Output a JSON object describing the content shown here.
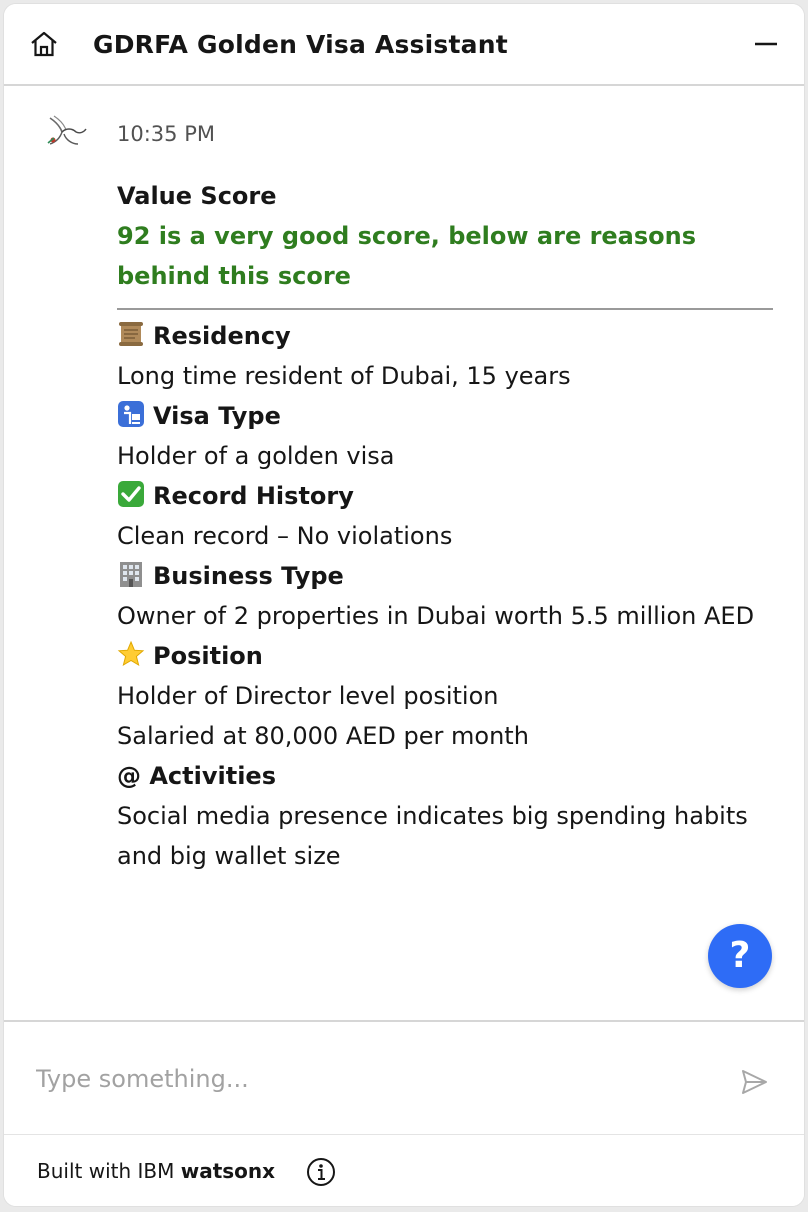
{
  "header": {
    "title": "GDRFA Golden Visa Assistant",
    "home_icon": "home-icon",
    "minimize_icon": "minimize-icon"
  },
  "message": {
    "avatar_icon": "bird-logo-icon",
    "time": "10:35 PM",
    "score_title": "Value Score",
    "score_subtitle": "92 is a very good score, below are reasons behind this score",
    "score": 92,
    "sections": [
      {
        "icon": "scroll-icon",
        "title": "Residency",
        "lines": [
          "Long time resident of Dubai, 15 years"
        ]
      },
      {
        "icon": "passport-control-icon",
        "title": "Visa Type",
        "lines": [
          "Holder of a golden visa"
        ]
      },
      {
        "icon": "check-mark-icon",
        "title": "Record History",
        "lines": [
          "Clean record – No violations"
        ]
      },
      {
        "icon": "office-building-icon",
        "title": "Business Type",
        "lines": [
          "Owner of 2 properties in Dubai worth 5.5 million AED"
        ]
      },
      {
        "icon": "star-icon",
        "title": "Position",
        "lines": [
          "Holder of Director level position",
          "Salaried at 80,000 AED per month"
        ]
      },
      {
        "icon": "at-sign",
        "title": "@ Activities",
        "lines": [
          "Social media presence indicates big spending habits and big wallet size"
        ]
      }
    ]
  },
  "help": {
    "label": "?"
  },
  "input": {
    "placeholder": "Type something...",
    "value": ""
  },
  "footer": {
    "prefix": "Built with IBM ",
    "brand": "watsonx"
  },
  "colors": {
    "accent": "#2e6cf6",
    "score_green": "#2f7d1f",
    "text": "#161616",
    "muted": "#a2a2a2"
  }
}
